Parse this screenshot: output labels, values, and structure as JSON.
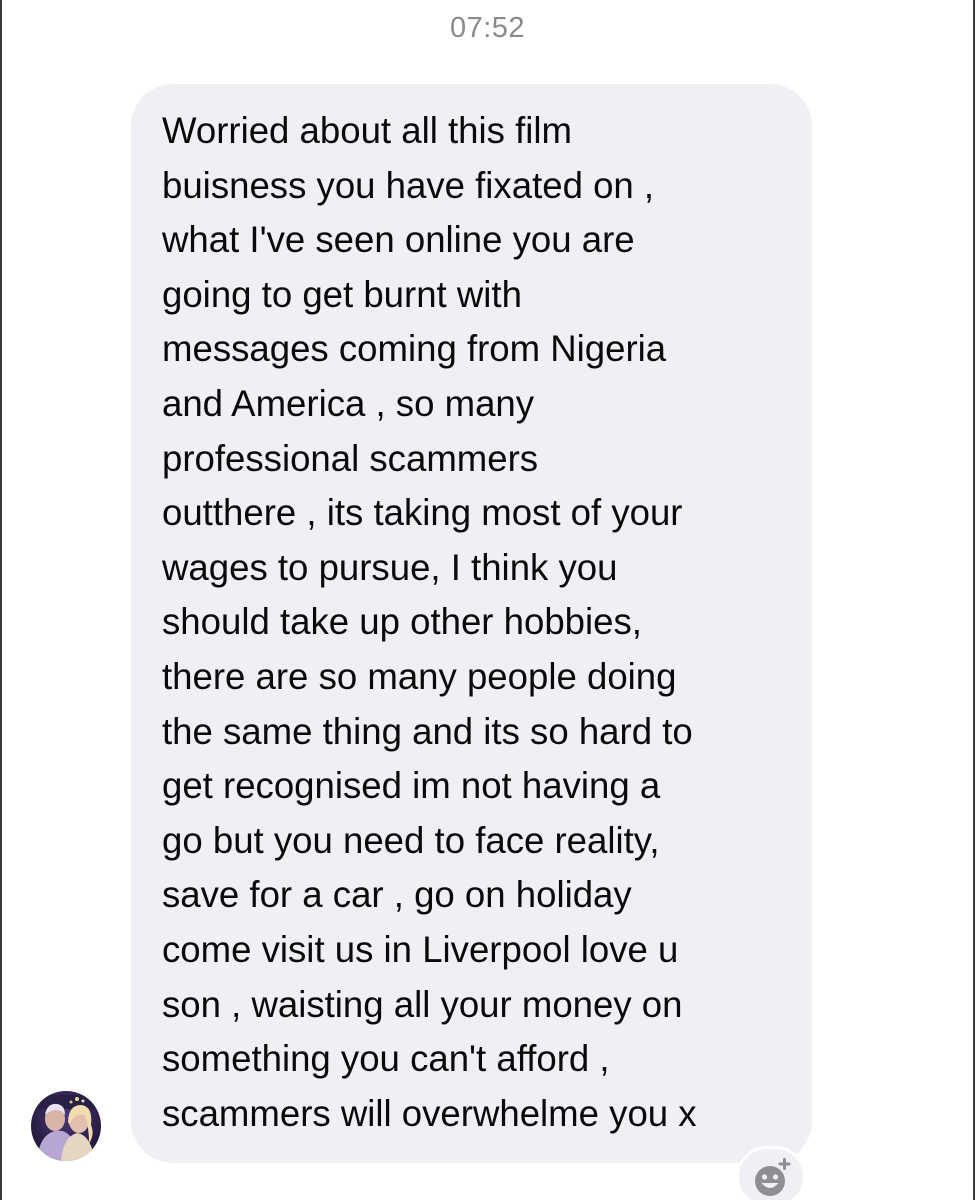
{
  "status": {
    "time": "07:52"
  },
  "message": {
    "sender": "incoming",
    "lines": [
      "Worried about all this film",
      "buisness you have fixated on ,",
      "what I've seen online you are",
      "going to get burnt with",
      "messages coming from Nigeria",
      "and America , so many",
      "professional scammers",
      "outthere , its taking most of your",
      "wages to pursue, I think you",
      "should take up other hobbies,",
      "there are so many people doing",
      "the same thing and its so hard to",
      "get recognised im not having a",
      "go but you need to face reality,",
      "save for a car , go on holiday",
      "come visit us in Liverpool love u",
      "son , waisting all your money on",
      "something you can't afford ,",
      "scammers will overwhelme you x"
    ]
  },
  "icons": {
    "avatar": "contact-avatar-photo",
    "reaction": "add-reaction-emoji-icon"
  },
  "colors": {
    "bubble": "#efeff4",
    "text": "#0a0a0a",
    "timestamp": "#8a8a8e"
  }
}
